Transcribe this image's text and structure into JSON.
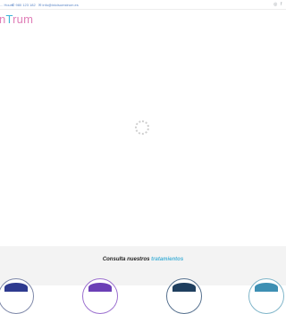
{
  "topbar": {
    "hours": "... Hours",
    "phone": "980 123 182",
    "email": "info@inicisumstrum.es",
    "social": [
      {
        "icon": "instagram-icon",
        "glyph": "◎"
      },
      {
        "icon": "facebook-icon",
        "glyph": "f"
      }
    ]
  },
  "logo": {
    "part1": "n",
    "part2": "T",
    "part3": "rum"
  },
  "loader": {
    "icon": "loading-spinner-icon"
  },
  "treatments": {
    "title_prefix": "Consulta nuestros",
    "title_accent": "tratamientos"
  },
  "colors": {
    "accent_blue": "#4ab3d8",
    "logo_pink": "#e07fb8",
    "band_background": "#f3f3f3"
  }
}
